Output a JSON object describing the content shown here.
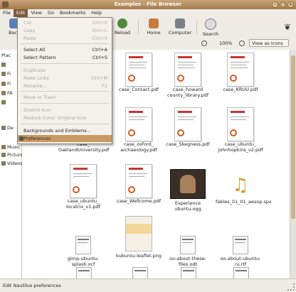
{
  "window": {
    "title": "Examples - File Browser"
  },
  "menubar": [
    "File",
    "Edit",
    "View",
    "Go",
    "Bookmarks",
    "Help"
  ],
  "toolbar": {
    "back": "Back",
    "reload": "Reload",
    "home": "Home",
    "computer": "Computer",
    "search": "Search"
  },
  "location": {
    "zoom": "100%",
    "view_mode": "View as Icons"
  },
  "sidebar": {
    "header": "Plac",
    "items": [
      "",
      "Fi",
      "Fi",
      "FA",
      "",
      "De",
      "Music",
      "Pictures",
      "Videos"
    ]
  },
  "edit_menu": {
    "items": [
      {
        "label": "Cut",
        "accel": "Ctrl+X",
        "enabled": false
      },
      {
        "label": "Copy",
        "accel": "Ctrl+C",
        "enabled": false
      },
      {
        "label": "Paste",
        "accel": "Ctrl+V",
        "enabled": false
      },
      {
        "label": "Select All",
        "accel": "Ctrl+A",
        "enabled": true
      },
      {
        "label": "Select Pattern",
        "accel": "Ctrl+S",
        "enabled": true
      },
      {
        "label": "Duplicate",
        "accel": "",
        "enabled": false
      },
      {
        "label": "Make Links",
        "accel": "Ctrl+M",
        "enabled": false
      },
      {
        "label": "Rename...",
        "accel": "F2",
        "enabled": false
      },
      {
        "label": "Move to Trash",
        "accel": "",
        "enabled": false
      },
      {
        "label": "Stretch Icon",
        "accel": "",
        "enabled": false
      },
      {
        "label": "Restore Icons' Original Size",
        "accel": "",
        "enabled": false
      },
      {
        "label": "Backgrounds and Emblems...",
        "accel": "",
        "enabled": true
      },
      {
        "label": "Preferences",
        "accel": "",
        "enabled": true
      }
    ]
  },
  "files": [
    {
      "name": "case_Contact.pdf",
      "kind": "doc"
    },
    {
      "name": "case_howard county_library.pdf",
      "kind": "doc"
    },
    {
      "name": "case_KRUU.pdf",
      "kind": "doc"
    },
    {
      "name": "case_ OaklandUniversity.pdf",
      "kind": "doc"
    },
    {
      "name": "case_oxford_ archaeology.pdf",
      "kind": "doc"
    },
    {
      "name": "case_Skegness.pdf",
      "kind": "doc"
    },
    {
      "name": "case_ubuntu_ johnhopkins_v2.pdf",
      "kind": "doc"
    },
    {
      "name": "case_ubuntu_ locatrix_v1.pdf",
      "kind": "doc"
    },
    {
      "name": "case_Wellcome.pdf",
      "kind": "doc"
    },
    {
      "name": "Experience ubuntu.ogg",
      "kind": "video"
    },
    {
      "name": "fables_01_01_aesop.spx",
      "kind": "audio"
    },
    {
      "name": "gimp-ubuntu-splash.xcf",
      "kind": "small"
    },
    {
      "name": "kubuntu-leaflet.png",
      "kind": "image"
    },
    {
      "name": "oo-about-these-files.odt",
      "kind": "small"
    },
    {
      "name": "oo-about-ubuntu-ru.rtf",
      "kind": "small"
    }
  ],
  "status": "Edit Nautilus preferences"
}
